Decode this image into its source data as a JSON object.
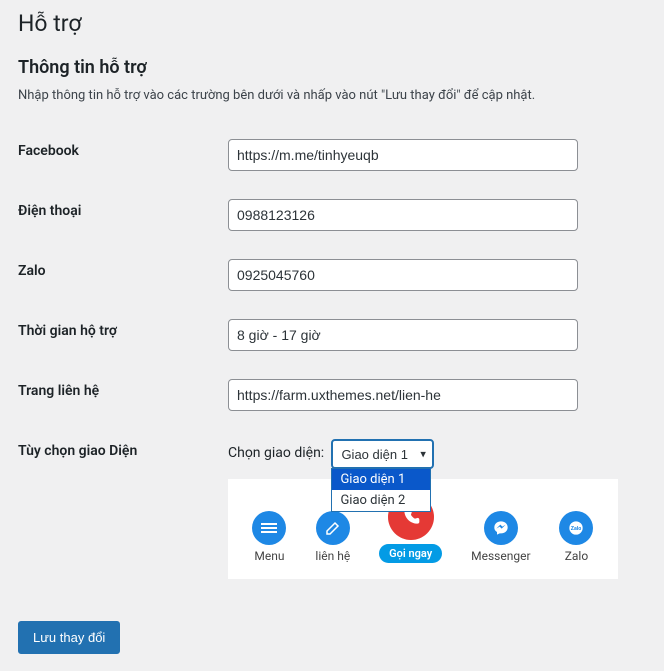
{
  "page": {
    "title": "Hỗ trợ",
    "section_title": "Thông tin hỗ trợ",
    "description": "Nhập thông tin hỗ trợ vào các trường bên dưới và nhấp vào nút \"Lưu thay đổi\" để cập nhật."
  },
  "fields": {
    "facebook": {
      "label": "Facebook",
      "value": "https://m.me/tinhyeuqb"
    },
    "phone": {
      "label": "Điện thoại",
      "value": "0988123126"
    },
    "zalo": {
      "label": "Zalo",
      "value": "0925045760"
    },
    "hours": {
      "label": "Thời gian hộ trợ",
      "value": "8 giờ - 17 giờ"
    },
    "contact": {
      "label": "Trang liên hệ",
      "value": "https://farm.uxthemes.net/lien-he"
    },
    "skin": {
      "label": "Tùy chọn giao Diện",
      "inline_label": "Chọn giao diện:",
      "selected": "Giao diện 1",
      "options": [
        "Giao diện 1",
        "Giao diện 2"
      ]
    }
  },
  "preview": {
    "menu": "Menu",
    "contact": "liên hệ",
    "call": "Gọi ngay",
    "messenger": "Messenger",
    "zalo": "Zalo"
  },
  "actions": {
    "save": "Lưu thay đổi"
  }
}
